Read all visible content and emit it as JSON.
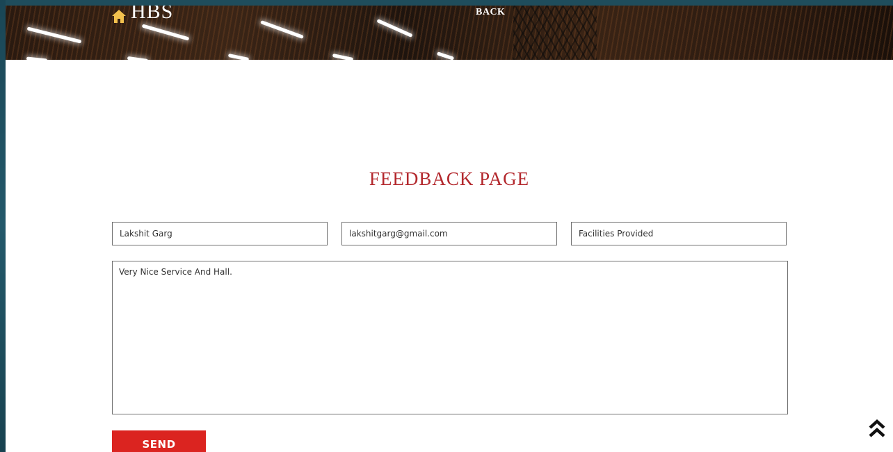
{
  "header": {
    "brand": "HBS",
    "back_label": "BACK"
  },
  "main": {
    "title": "FEEDBACK PAGE",
    "name_value": "Lakshit Garg",
    "email_value": "lakshitgarg@gmail.com",
    "subject_value": "Facilities Provided",
    "message_value": "Very Nice Service And Hall.",
    "send_label": "SEND"
  },
  "icons": {
    "brand_icon": "home-icon",
    "scroll_top_icon": "double-chevron-up-icon"
  },
  "colors": {
    "title": "#b3282d",
    "send_button": "#db2420",
    "brand_icon": "#f2c14e"
  }
}
